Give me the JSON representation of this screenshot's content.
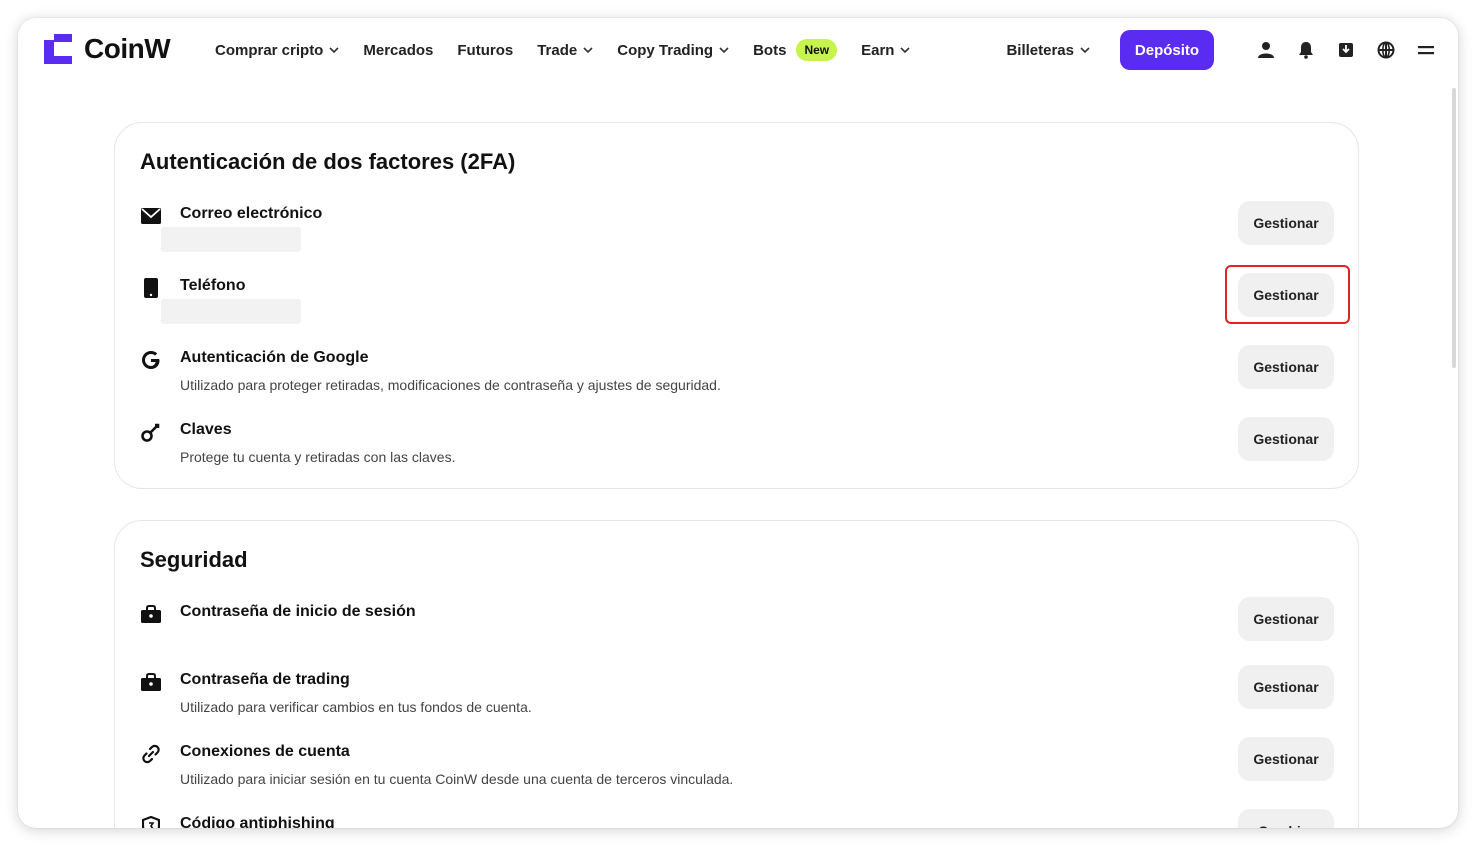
{
  "brand": {
    "name": "CoinW",
    "accent": "#5a2bf0"
  },
  "nav": {
    "items": [
      {
        "label": "Comprar cripto",
        "dropdown": true
      },
      {
        "label": "Mercados",
        "dropdown": false
      },
      {
        "label": "Futuros",
        "dropdown": false
      },
      {
        "label": "Trade",
        "dropdown": true
      },
      {
        "label": "Copy Trading",
        "dropdown": true
      },
      {
        "label": "Bots",
        "dropdown": false,
        "badge": "New"
      },
      {
        "label": "Earn",
        "dropdown": true
      }
    ],
    "wallet_label": "Billeteras",
    "deposit_label": "Depósito",
    "icons": [
      "user-icon",
      "bell-icon",
      "download-icon",
      "globe-icon",
      "menu-icon"
    ]
  },
  "twofa": {
    "title": "Autenticación de dos factores (2FA)",
    "rows": [
      {
        "icon": "mail-icon",
        "title": "Correo electrónico",
        "desc": "",
        "masked": true,
        "button": "Gestionar"
      },
      {
        "icon": "phone-icon",
        "title": "Teléfono",
        "desc": "",
        "masked": true,
        "button": "Gestionar",
        "highlighted": true
      },
      {
        "icon": "google-icon",
        "title": "Autenticación de Google",
        "desc": "Utilizado para proteger retiradas, modificaciones de contraseña y ajustes de seguridad.",
        "button": "Gestionar"
      },
      {
        "icon": "key-icon",
        "title": "Claves",
        "desc": "Protege tu cuenta y retiradas con las claves.",
        "button": "Gestionar"
      }
    ]
  },
  "security": {
    "title": "Seguridad",
    "rows": [
      {
        "icon": "lock-briefcase-icon",
        "title": "Contraseña de inicio de sesión",
        "desc": "",
        "button": "Gestionar"
      },
      {
        "icon": "lock-briefcase-icon",
        "title": "Contraseña de trading",
        "desc": "Utilizado para verificar cambios en tus fondos de cuenta.",
        "button": "Gestionar"
      },
      {
        "icon": "link-icon",
        "title": "Conexiones de cuenta",
        "desc": "Utilizado para iniciar sesión en tu cuenta CoinW desde una cuenta de terceros vinculada.",
        "button": "Gestionar"
      },
      {
        "icon": "shield-icon",
        "title": "Código antiphishing",
        "desc": "",
        "button": "Cambiar"
      }
    ]
  }
}
